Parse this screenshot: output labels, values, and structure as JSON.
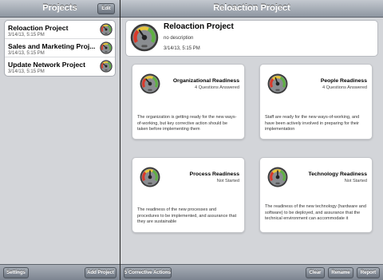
{
  "left": {
    "title": "Projects",
    "edit_label": "Edit",
    "settings_label": "Settings",
    "add_project_label": "Add Project",
    "projects": [
      {
        "name": "Reloaction Project",
        "date": "3/14/13, 5:15 PM"
      },
      {
        "name": "Sales and Marketing Proj...",
        "date": "3/14/13, 5:15 PM"
      },
      {
        "name": "Update Network Project",
        "date": "3/14/13, 5:15 PM"
      }
    ]
  },
  "right": {
    "title": "Reloaction Project",
    "header": {
      "name": "Reloaction Project",
      "description": "no description",
      "date": "3/14/13, 5:15 PM"
    },
    "cards": [
      {
        "title": "Organizational Readiness",
        "status": "4 Questions Answered",
        "description": "The organization is getting ready for the new ways-of-working, but key corrective action should be taken before implementing them"
      },
      {
        "title": "People Readiness",
        "status": "4 Questions Answered",
        "description": "Staff are ready for the new ways-of-working, and have been actively involved in preparing for their implementation"
      },
      {
        "title": "Process Readiness",
        "status": "Not Started",
        "description": "The readiness of the new processes and procedures to be implemented, and assurance that they are sustainable"
      },
      {
        "title": "Technology Readiness",
        "status": "Not Started",
        "description": "The readiness of the new technology (hardware and software) to be deployed, and assurance that the technical environment can accommodate it"
      }
    ],
    "toolbar": {
      "corrective_label": "5 Corrective Actions",
      "clear_label": "Clear",
      "rename_label": "Rename",
      "report_label": "Report"
    }
  },
  "colors": {
    "gauge_red": "#d93a2b",
    "gauge_yellow": "#e8c53a",
    "gauge_green": "#5fb043",
    "bezel": "#3a3a3a"
  },
  "icons": {
    "gauge": "gauge-icon"
  }
}
